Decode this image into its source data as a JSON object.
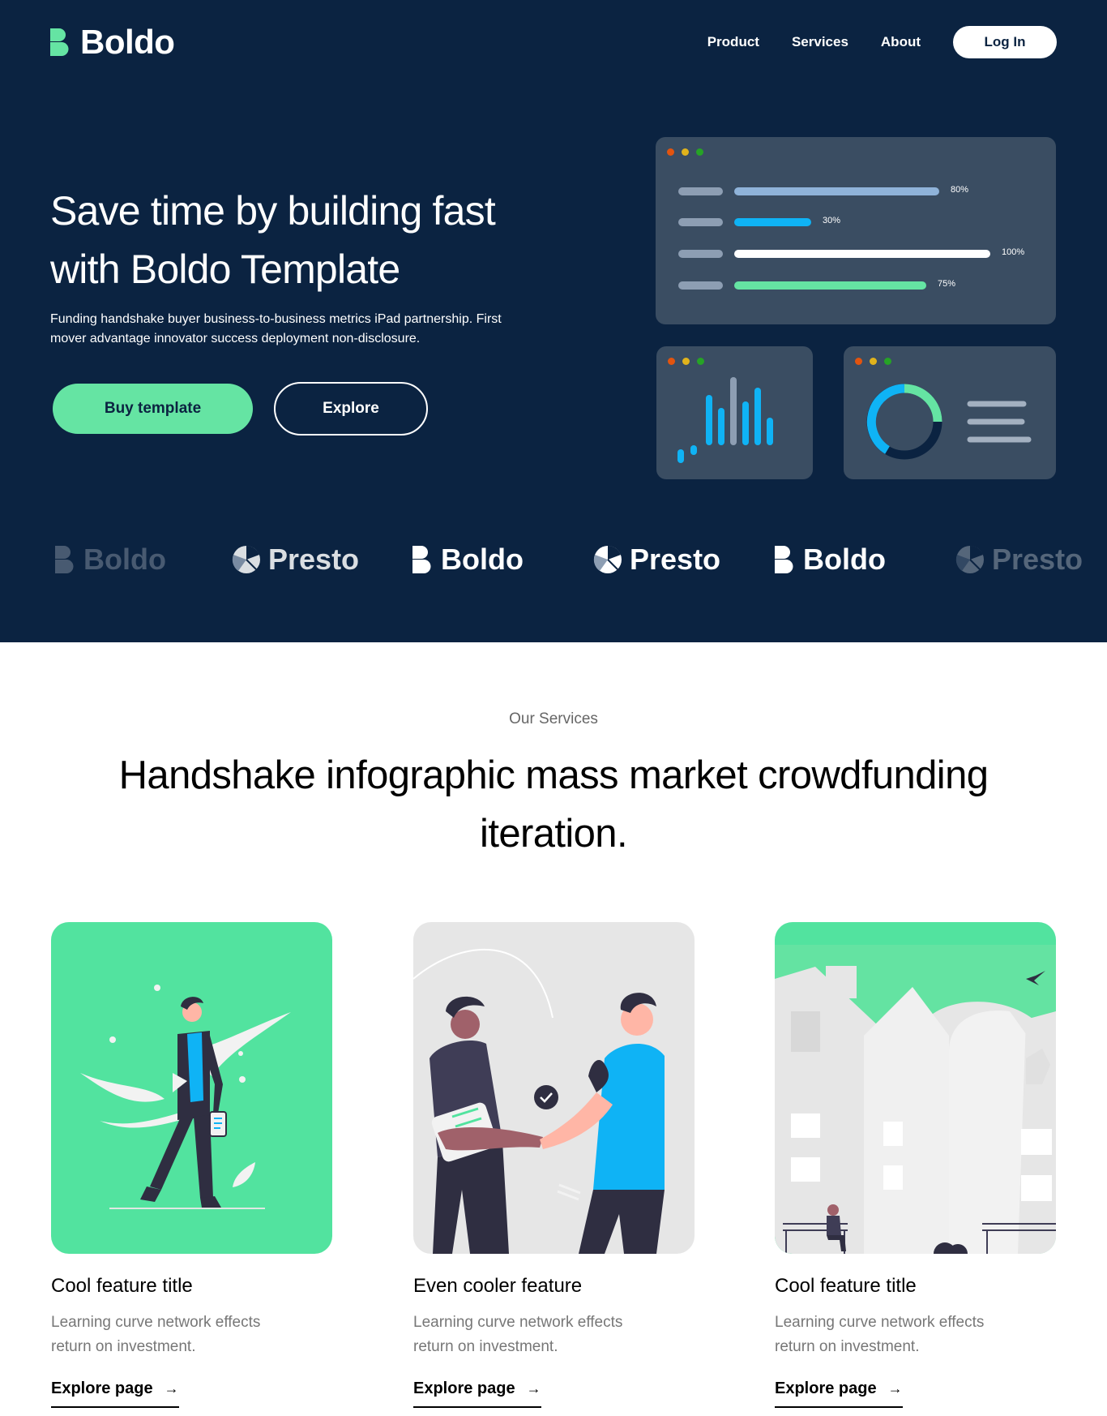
{
  "brand": {
    "name": "Boldo",
    "colors": {
      "navy": "#0b2341",
      "green": "#65e4a3",
      "blue": "#0fb3f5",
      "panel": "#3a4d62"
    }
  },
  "nav": {
    "items": [
      {
        "label": "Product"
      },
      {
        "label": "Services"
      },
      {
        "label": "About"
      }
    ],
    "login_label": "Log In"
  },
  "hero": {
    "title": "Save time by building fast with Boldo Template",
    "description": "Funding handshake buyer business-to-business metrics iPad partnership. First mover advantage innovator success deployment non-disclosure.",
    "buy_label": "Buy template",
    "explore_label": "Explore"
  },
  "dashboard": {
    "progress": [
      {
        "label": "80%",
        "value": 0.8,
        "color": "#8fb3d9"
      },
      {
        "label": "30%",
        "value": 0.3,
        "color": "#0fb3f5"
      },
      {
        "label": "100%",
        "value": 1.0,
        "color": "#ffffff"
      },
      {
        "label": "75%",
        "value": 0.75,
        "color": "#65e4a3"
      }
    ]
  },
  "logos": [
    {
      "name": "Boldo",
      "kind": "boldo"
    },
    {
      "name": "Presto",
      "kind": "presto"
    },
    {
      "name": "Boldo",
      "kind": "boldo"
    },
    {
      "name": "Presto",
      "kind": "presto"
    },
    {
      "name": "Boldo",
      "kind": "boldo"
    },
    {
      "name": "Presto",
      "kind": "presto"
    }
  ],
  "services": {
    "eyebrow": "Our Services",
    "title": "Handshake infographic mass market crowdfunding iteration.",
    "features": [
      {
        "title": "Cool feature title",
        "description": "Learning curve network effects return on investment.",
        "link": "Explore page",
        "icon": "arrow-right-icon"
      },
      {
        "title": "Even cooler feature",
        "description": "Learning curve network effects return on investment.",
        "link": "Explore page",
        "icon": "arrow-right-icon"
      },
      {
        "title": "Cool feature title",
        "description": "Learning curve network effects return on investment.",
        "link": "Explore page",
        "icon": "arrow-right-icon"
      }
    ]
  }
}
